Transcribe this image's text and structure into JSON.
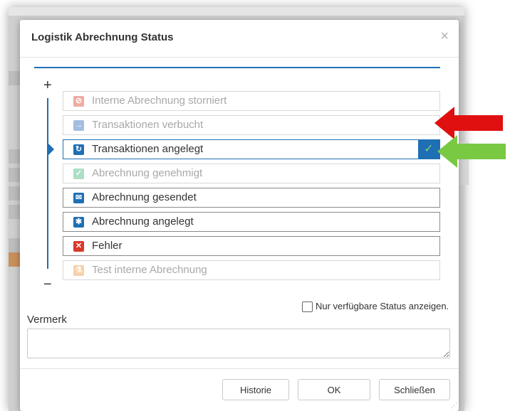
{
  "dialog": {
    "title": "Logistik Abrechnung Status",
    "close_glyph": "×"
  },
  "tree": {
    "expand_glyph": "+",
    "collapse_glyph": "−"
  },
  "statuses": [
    {
      "label": "Interne Abrechnung storniert",
      "icon": "cancel-icon",
      "icon_glyph": "⊘",
      "color": "#e05a4a",
      "state": "disabled"
    },
    {
      "label": "Transaktionen verbucht",
      "icon": "arrow-right-icon",
      "icon_glyph": "→",
      "color": "#4a7fc1",
      "state": "disabled"
    },
    {
      "label": "Transaktionen angelegt",
      "icon": "refresh-icon",
      "icon_glyph": "↻",
      "color": "#1f6fb5",
      "state": "selected",
      "check": "✓"
    },
    {
      "label": "Abrechnung genehmigt",
      "icon": "check-icon",
      "icon_glyph": "✓",
      "color": "#5cc08a",
      "state": "disabled"
    },
    {
      "label": "Abrechnung gesendet",
      "icon": "envelope-icon",
      "icon_glyph": "✉",
      "color": "#1f6fb5",
      "state": "enabled"
    },
    {
      "label": "Abrechnung angelegt",
      "icon": "asterisk-icon",
      "icon_glyph": "✱",
      "color": "#1f6fb5",
      "state": "enabled"
    },
    {
      "label": "Fehler",
      "icon": "error-x-icon",
      "icon_glyph": "✕",
      "color": "#d9392b",
      "state": "enabled"
    },
    {
      "label": "Test interne Abrechnung",
      "icon": "flask-icon",
      "icon_glyph": "⚗",
      "color": "#f0a35a",
      "state": "disabled"
    }
  ],
  "filter": {
    "only_available_label": "Nur verfügbare Status anzeigen.",
    "checked": false
  },
  "note": {
    "label": "Vermerk",
    "value": ""
  },
  "buttons": {
    "history": "Historie",
    "ok": "OK",
    "close": "Schließen"
  },
  "colors": {
    "accent": "#1f6fb5",
    "annotation_red": "#e01010",
    "annotation_green": "#7ac943"
  }
}
